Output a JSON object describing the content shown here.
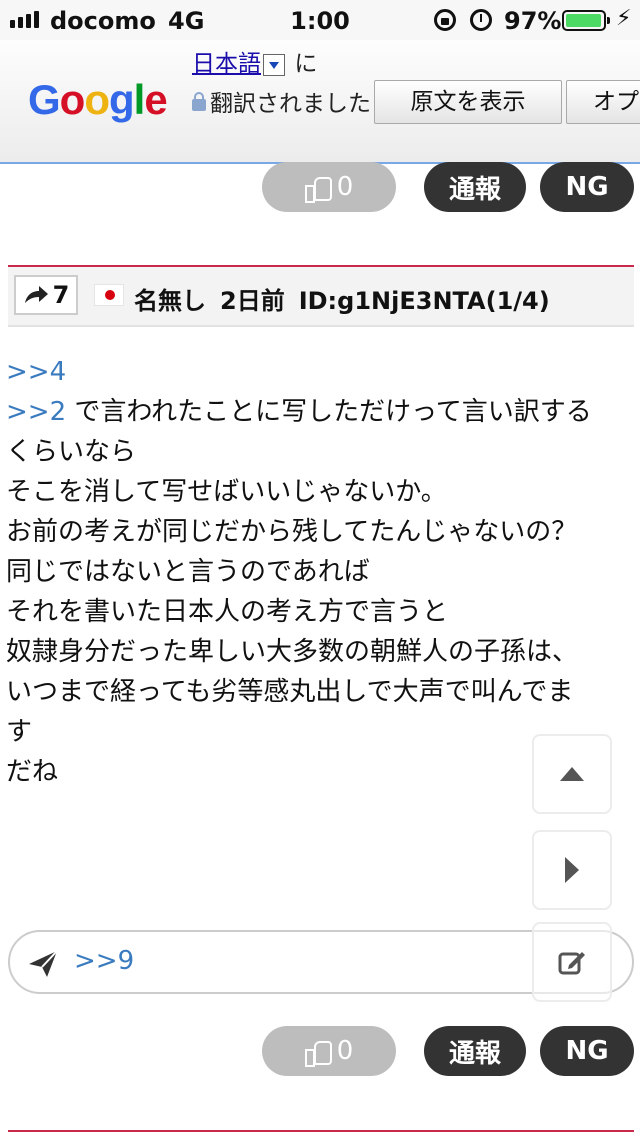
{
  "status_bar": {
    "carrier": "docomo",
    "network": "4G",
    "time": "1:00",
    "battery_percent": "97%",
    "battery_level": 0.97,
    "icons": [
      "signal-icon",
      "orientation-lock-icon",
      "alarm-icon",
      "battery-icon",
      "charging-icon"
    ]
  },
  "translate_bar": {
    "language": "日本語",
    "message_particle": "に",
    "message": "翻訳されました",
    "show_original_label": "原文を表示",
    "options_label": "オプ",
    "logo": "Google"
  },
  "actions_top": {
    "like_count": "0",
    "report_label": "通報",
    "ng_label": "NG"
  },
  "post": {
    "share_count": "7",
    "name": "名無し",
    "time_ago": "2日前",
    "id": "ID:g1NjE3NTA(1/4)",
    "anchors": [
      ">>4",
      ">>2"
    ],
    "lines": [
      " で言われたことに写しただけって言い訳する",
      "くらいなら",
      "そこを消して写せばいいじゃないか。",
      "お前の考えが同じだから残してたんじゃないの？",
      "",
      "同じではないと言うのであれば",
      "それを書いた日本人の考え方で言うと",
      "",
      "奴隷身分だった卑しい大多数の朝鮮人の子孫は、",
      "いつまで経っても劣等感丸出しで大声で叫んでま",
      "す",
      "だね"
    ]
  },
  "reply": {
    "text": ">>9"
  },
  "actions_bottom": {
    "like_count": "0",
    "report_label": "通報",
    "ng_label": "NG"
  },
  "colors": {
    "accent_red": "#c8284a",
    "anchor_blue": "#3a7bbf",
    "button_dark": "#333333",
    "button_grey": "#bdbdbd"
  }
}
